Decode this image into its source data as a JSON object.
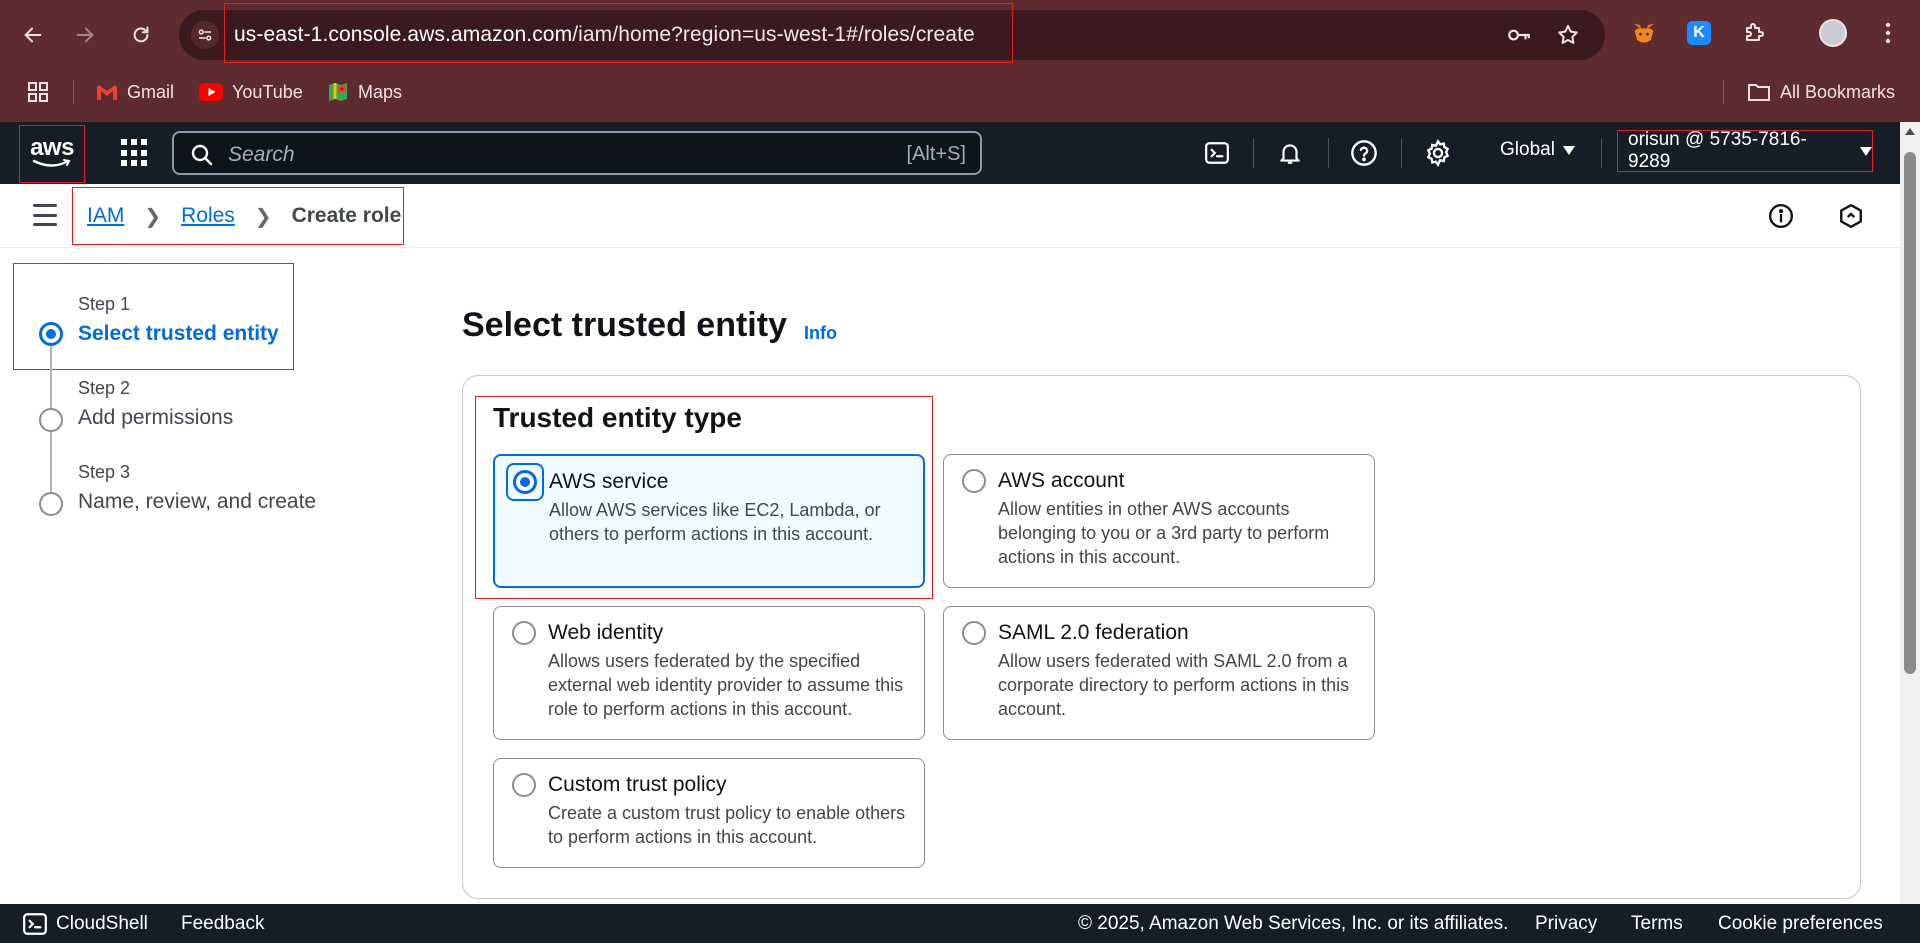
{
  "browser": {
    "url_host": "us-east-1.console.aws.amazon.com",
    "url_path": "/iam/home?region=us-west-1#/roles/create",
    "bookmarks": [
      {
        "label": "Gmail"
      },
      {
        "label": "YouTube"
      },
      {
        "label": "Maps"
      }
    ],
    "all_bookmarks": "All Bookmarks"
  },
  "aws_nav": {
    "logo_text": "aws",
    "search_placeholder": "Search",
    "search_shortcut": "[Alt+S]",
    "region": "Global",
    "account": "orisun @ 5735-7816-9289"
  },
  "breadcrumb": {
    "items": [
      "IAM",
      "Roles"
    ],
    "current": "Create role"
  },
  "wizard": {
    "steps": [
      {
        "step": "Step 1",
        "title": "Select trusted entity"
      },
      {
        "step": "Step 2",
        "title": "Add permissions"
      },
      {
        "step": "Step 3",
        "title": "Name, review, and create"
      }
    ]
  },
  "main": {
    "title": "Select trusted entity",
    "info": "Info",
    "panel_title": "Trusted entity type",
    "options": [
      {
        "title": "AWS service",
        "desc": "Allow AWS services like EC2, Lambda, or others to perform actions in this account."
      },
      {
        "title": "AWS account",
        "desc": "Allow entities in other AWS accounts belonging to you or a 3rd party to perform actions in this account."
      },
      {
        "title": "Web identity",
        "desc": "Allows users federated by the specified external web identity provider to assume this role to perform actions in this account."
      },
      {
        "title": "SAML 2.0 federation",
        "desc": "Allow users federated with SAML 2.0 from a corporate directory to perform actions in this account."
      },
      {
        "title": "Custom trust policy",
        "desc": "Create a custom trust policy to enable others to perform actions in this account."
      }
    ]
  },
  "footer": {
    "cloudshell": "CloudShell",
    "feedback": "Feedback",
    "copyright": "© 2025, Amazon Web Services, Inc. or its affiliates.",
    "privacy": "Privacy",
    "terms": "Terms",
    "cookies": "Cookie preferences"
  },
  "colors": {
    "chrome": "#5e2b30",
    "aws_nav": "#161d26",
    "accent": "#006ce0",
    "highlight": "#e0211f"
  }
}
